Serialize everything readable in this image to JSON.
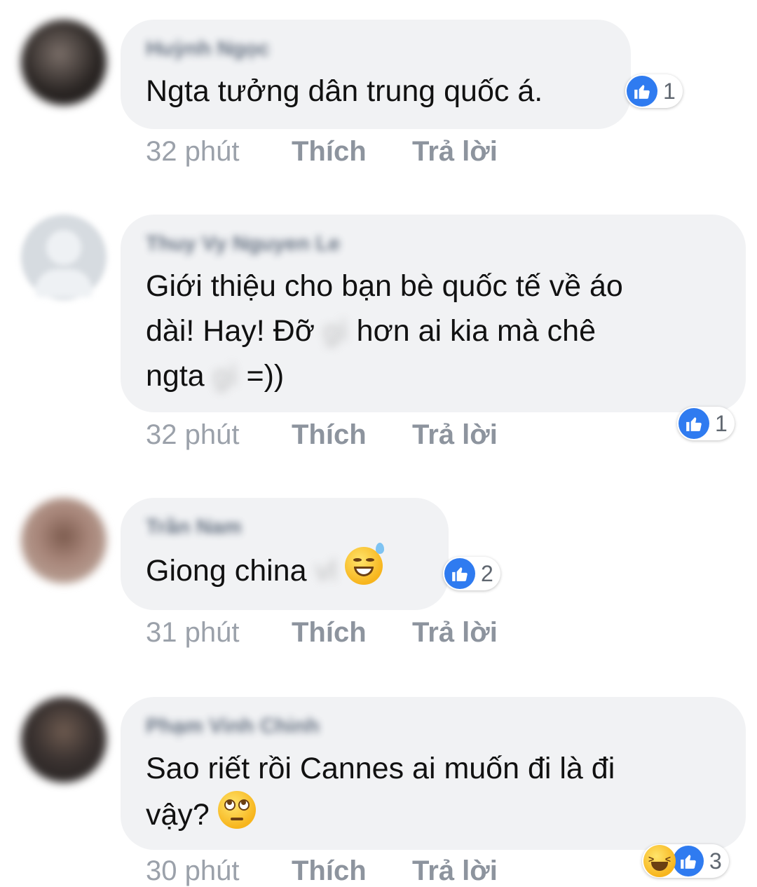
{
  "comments": [
    {
      "author": "Huỳnh Ngọc",
      "lines": [
        "Ngta tưởng dân trung quốc á."
      ],
      "time": "32 phút",
      "like_label": "Thích",
      "reply_label": "Trả lời",
      "reaction_count": "1"
    },
    {
      "author": "Thuy Vy Nguyen Le",
      "line1": "Giới thiệu cho bạn bè quốc tế về áo",
      "line2_start": "dài! Hay! Đỡ",
      "line2_end": "hơn ai kia mà chê",
      "line3_start": "ngta",
      "line3_end": "=))",
      "time": "32 phút",
      "like_label": "Thích",
      "reply_label": "Trả lời",
      "reaction_count": "1"
    },
    {
      "author": "Trần Nam",
      "text_start": "Giong china",
      "emoji": "sweat-smile-emoji",
      "time": "31 phút",
      "like_label": "Thích",
      "reply_label": "Trả lời",
      "reaction_count": "2"
    },
    {
      "author": "Phạm Vinh Chinh",
      "line1": "Sao riết rồi Cannes ai muốn đi là đi",
      "line2": "vậy?",
      "emoji": "eye-roll-emoji",
      "time": "30 phút",
      "like_label": "Thích",
      "reply_label": "Trả lời",
      "reaction_count": "3"
    }
  ],
  "colors": {
    "bubble": "#f1f2f4",
    "like_blue": "#2f7bf0",
    "meta_gray": "#9ba1aa"
  }
}
